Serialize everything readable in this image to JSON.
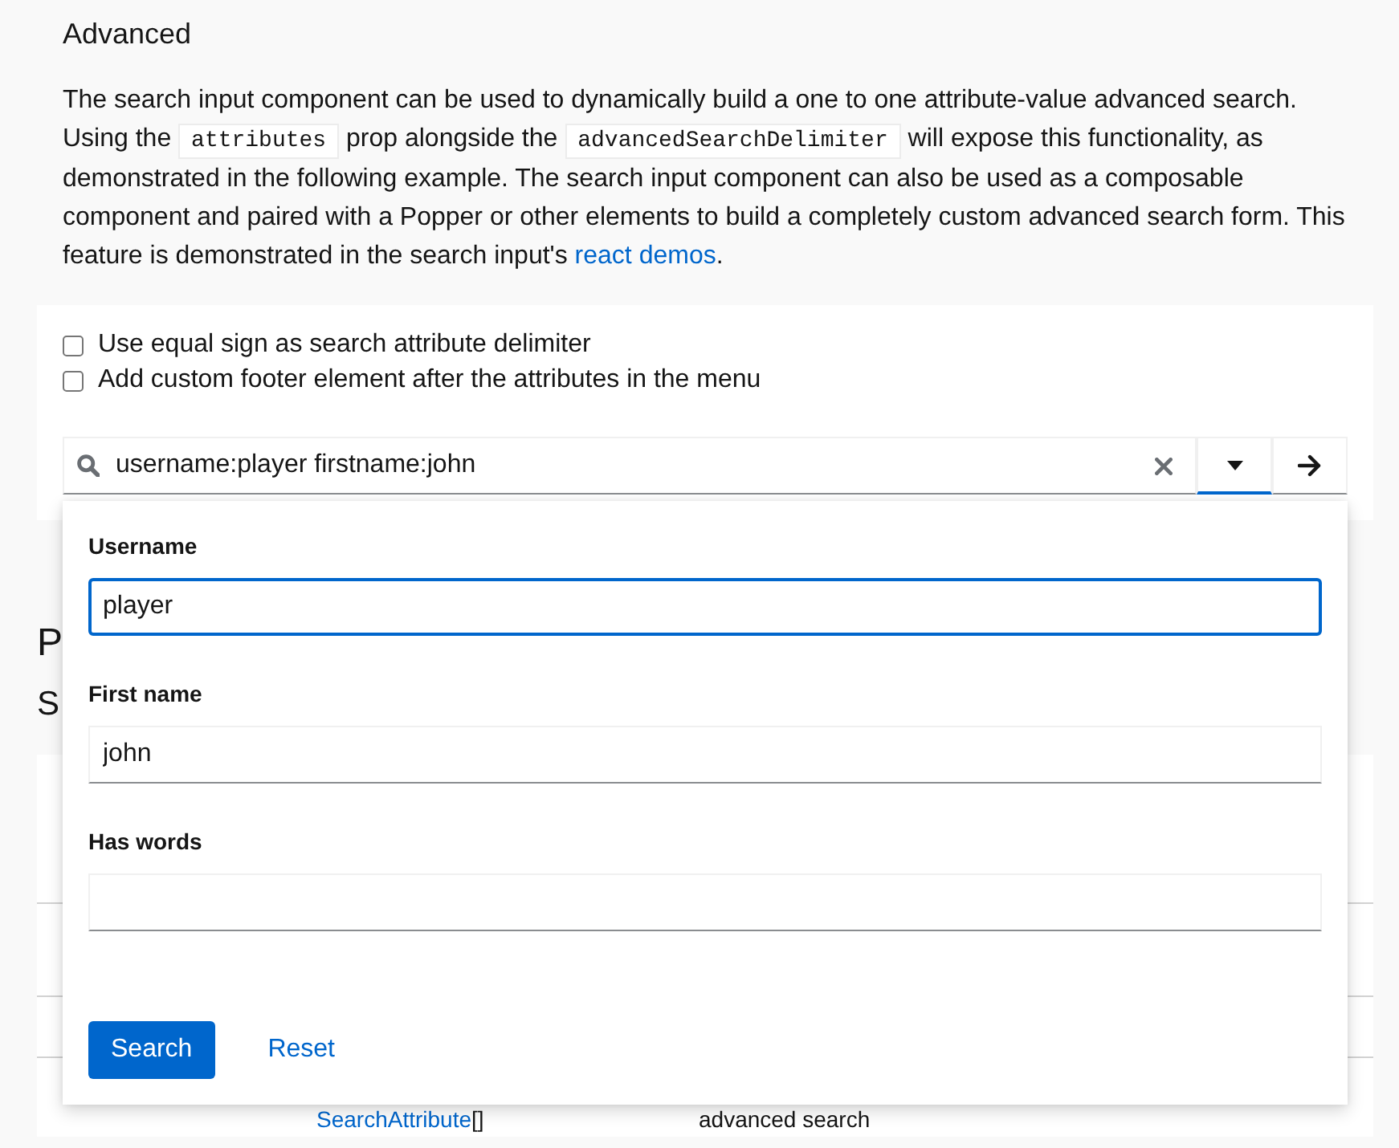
{
  "intro": {
    "title": "Advanced",
    "paragraph": [
      {
        "kind": "text",
        "text": "The search input component can be used to dynamically build a one to one attribute-value advanced search. Using the "
      },
      {
        "kind": "code",
        "text": "attributes"
      },
      {
        "kind": "text",
        "text": " prop alongside the "
      },
      {
        "kind": "code",
        "text": "advancedSearchDelimiter"
      },
      {
        "kind": "text",
        "text": " will expose this functionality, as demonstrated in the following example. The search input component can also be used as a composable component and paired with a Popper or other elements to build a completely custom advanced search form. This feature is demonstrated in the search input's "
      },
      {
        "kind": "link",
        "text": "react demos"
      },
      {
        "kind": "text",
        "text": "."
      }
    ]
  },
  "example": {
    "checkboxes": [
      {
        "label": "Use equal sign as search attribute delimiter",
        "checked": false
      },
      {
        "label": "Add custom footer element after the attributes in the menu",
        "checked": false
      }
    ],
    "search": {
      "value": "username:player firstname:john",
      "expanded": true
    },
    "menu": {
      "fields": [
        {
          "label": "Username",
          "value": "player",
          "focused": true
        },
        {
          "label": "First name",
          "value": "john",
          "focused": false
        },
        {
          "label": "Has words",
          "focused": false
        }
      ],
      "actions": [
        {
          "label": "Search",
          "kind": "primary"
        },
        {
          "label": "Reset",
          "kind": "link"
        }
      ]
    }
  },
  "props": {
    "title": "P",
    "subtitle": "S",
    "table": {
      "rows": [
        {
          "cells": [
            {
              "link": "SearchAttribute",
              "text": "[]"
            },
            {
              "text": "advanced search"
            }
          ]
        }
      ]
    }
  }
}
